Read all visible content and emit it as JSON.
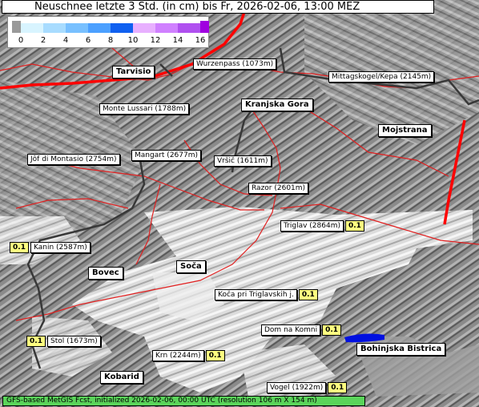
{
  "title": "Neuschnee letzte 3 Std. (in cm) bis Fr, 2026-02-06, 13:00 MEZ",
  "legend": {
    "ticks": [
      "0",
      "2",
      "4",
      "6",
      "8",
      "10",
      "12",
      "14",
      "16"
    ],
    "colors": [
      "#d8f4ff",
      "#a8dcff",
      "#78c0ff",
      "#4ca0ff",
      "#1060f0",
      "#e8b0ff",
      "#d080ff",
      "#b050f0"
    ]
  },
  "places": [
    {
      "name": "Tarvisio",
      "type": "town"
    },
    {
      "name": "Wurzenpass (1073m)",
      "type": "station"
    },
    {
      "name": "Mittagskogel/Kepa (2145m)",
      "type": "station"
    },
    {
      "name": "Monte Lussari (1788m)",
      "type": "station"
    },
    {
      "name": "Kranjska Gora",
      "type": "town"
    },
    {
      "name": "Mojstrana",
      "type": "town"
    },
    {
      "name": "Jôf di Montasio (2754m)",
      "type": "station"
    },
    {
      "name": "Mangart (2677m)",
      "type": "station"
    },
    {
      "name": "Vršič (1611m)",
      "type": "station"
    },
    {
      "name": "Razor (2601m)",
      "type": "station"
    },
    {
      "name": "Triglav (2864m)",
      "type": "station",
      "value": "0.1"
    },
    {
      "name": "Kanin (2587m)",
      "type": "station",
      "value": "0.1"
    },
    {
      "name": "Soča",
      "type": "town"
    },
    {
      "name": "Bovec",
      "type": "town"
    },
    {
      "name": "Koča pri Triglavskih j.",
      "type": "station",
      "value": "0.1"
    },
    {
      "name": "Dom na Komni",
      "type": "station",
      "value": "0.1"
    },
    {
      "name": "Stol (1673m)",
      "type": "station",
      "value": "0.1"
    },
    {
      "name": "Bohinjska Bistrica",
      "type": "town"
    },
    {
      "name": "Krn (2244m)",
      "type": "station",
      "value": "0.1"
    },
    {
      "name": "Kobarid",
      "type": "town"
    },
    {
      "name": "Vogel (1922m)",
      "type": "station",
      "value": "0.1"
    }
  ],
  "footer": "GFS-based MetGIS Fcst, initialized 2026-02-06, 00:00 UTC  (resolution 106 m X 154 m)"
}
